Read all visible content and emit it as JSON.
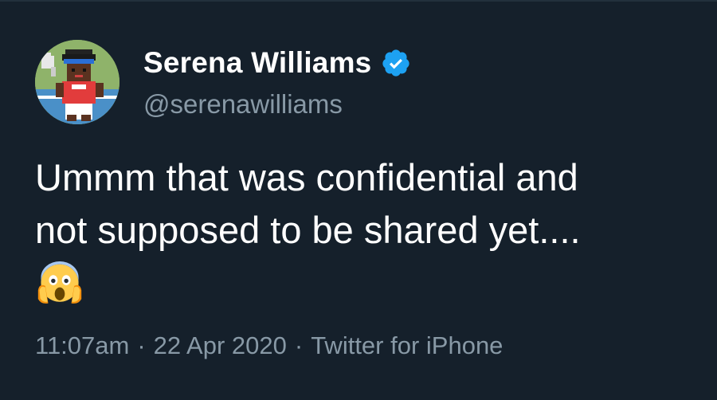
{
  "tweet": {
    "author": {
      "display_name": "Serena Williams",
      "handle": "@serenawilliams",
      "verified": true,
      "avatar_icon": "pixel-art-avatar-icon",
      "verified_icon": "verified-badge-icon"
    },
    "text_lines": [
      "Ummm that was confidential and",
      "not supposed to be shared yet...."
    ],
    "emoji_icon": "face-screaming-in-fear-icon",
    "time": "11:07am",
    "date": "22 Apr 2020",
    "source": "Twitter for iPhone",
    "separator": "·"
  },
  "colors": {
    "background": "#15202b",
    "text_primary": "#ffffff",
    "text_secondary": "#8899a6",
    "verified_blue": "#1da1f2"
  }
}
